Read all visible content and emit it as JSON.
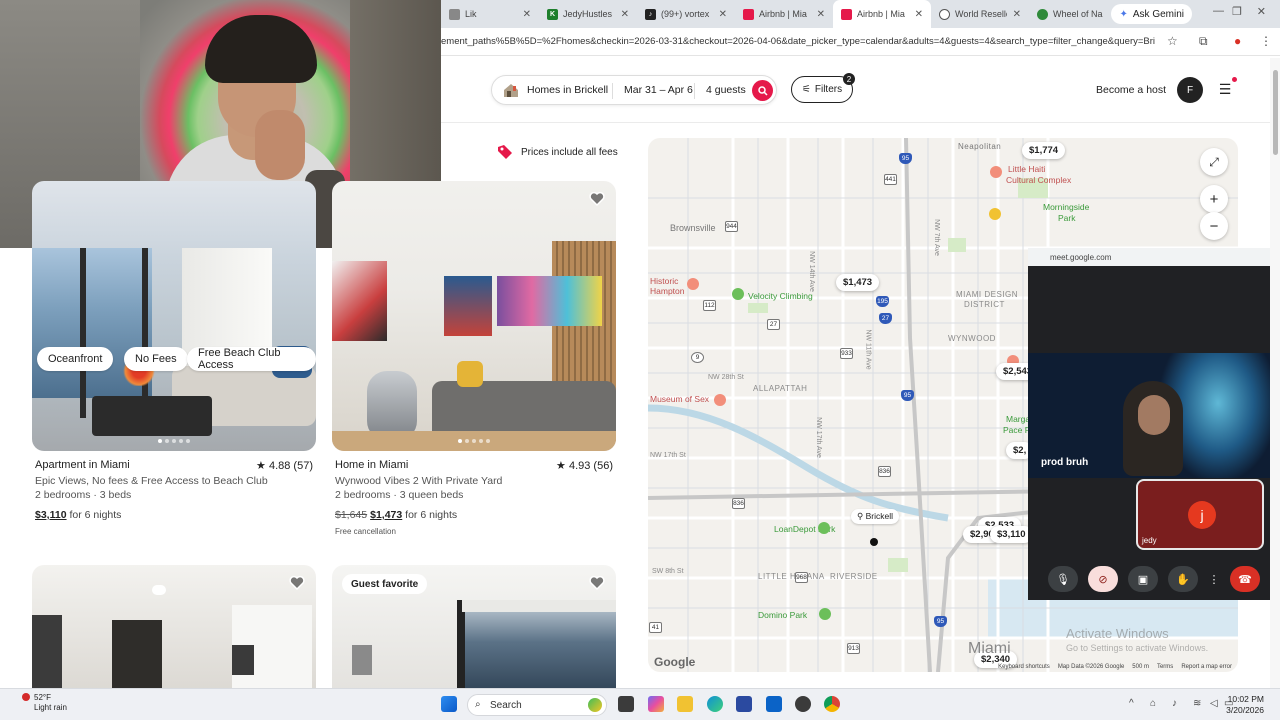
{
  "browser": {
    "tabs": [
      {
        "title": "Lik",
        "color": "#666666",
        "active": false
      },
      {
        "title": "JedyHustles",
        "color": "#1e7f2c",
        "active": false
      },
      {
        "title": "(99+) vortex",
        "color": "#222222",
        "active": false
      },
      {
        "title": "Airbnb | Mia",
        "color": "#e5194a",
        "active": false
      },
      {
        "title": "Airbnb | Mia",
        "color": "#e5194a",
        "active": true
      },
      {
        "title": "World Reselle",
        "color": "#555555",
        "active": false
      },
      {
        "title": "Wheel of Na",
        "color": "#2f8a3a",
        "active": false
      }
    ],
    "ask_gemini": "Ask Gemini",
    "url": "ement_paths%5B%5D=%2Fhomes&checkin=2026-03-31&checkout=2026-04-06&date_picker_type=calendar&adults=4&guests=4&search_type=filter_change&query=Bri..."
  },
  "header": {
    "location": "Homes in Brickell",
    "dates": "Mar 31 – Apr 6",
    "guests": "4 guests",
    "filters_label": "Filters",
    "filters_count": "2",
    "become_host": "Become a host",
    "avatar_initial": "F",
    "prices_note": "Prices include all fees"
  },
  "listings": [
    {
      "type": "Apartment in Miami",
      "rating": "★ 4.88 (57)",
      "desc": "Epic Views, No fees & Free Access to Beach Club",
      "beds": "2 bedrooms · 3 beds",
      "price": "$3,110",
      "price_old": "",
      "per": "for 6 nights",
      "pills": [
        "Oceanfront",
        "No Fees",
        "Free Beach Club Access"
      ]
    },
    {
      "type": "Home in Miami",
      "rating": "★ 4.93 (56)",
      "desc": "Wynwood Vibes 2 With Private Yard",
      "beds": "2 bedrooms · 3 queen beds",
      "price": "$1,473",
      "price_old": "$1,645",
      "per": "for 6 nights",
      "extra": "Free cancellation"
    },
    {
      "badge": ""
    },
    {
      "badge": "Guest favorite"
    }
  ],
  "map": {
    "prices": [
      "$1,774",
      "$1,473",
      "$2,543",
      "$2,",
      "$2,533",
      "$2,90",
      "$3,110",
      "$2,340"
    ],
    "labels": {
      "brownsville": "Brownsville",
      "neapolitan": "Neapolitan",
      "little_haiti": "Little Haiti",
      "cultural": "Cultural Complex",
      "morningside": "Morningside",
      "park": "Park",
      "miami_design": "MIAMI DESIGN",
      "district": "DISTRICT",
      "wynwood": "WYNWOOD",
      "allapattah": "ALLAPATTAH",
      "historic": "Historic",
      "hampton": "Hampton",
      "museum": "Museum of Sex",
      "velocity": "Velocity Climbing",
      "margaret": "Margaret",
      "pace_park": "Pace Park",
      "brickell": "Brickell",
      "loandepot": "LoanDepot Park",
      "little_havana": "LITTLE HAVANA",
      "riverside": "RIVERSIDE",
      "domino": "Domino Park",
      "miami": "Miami",
      "nw28": "NW 28th St",
      "nw17": "NW 17th St",
      "nw14": "NW 14th Ave",
      "nw11": "NW 11th Ave",
      "nw17ave": "NW 17th Ave",
      "nw7": "NW 7th Ave",
      "sw8": "SW 8th St"
    },
    "highways": [
      "95",
      "441",
      "944",
      "112",
      "27",
      "9",
      "933",
      "836",
      "95",
      "195",
      "27",
      "836",
      "968",
      "41",
      "913",
      "95"
    ],
    "google": "Google",
    "attribution": [
      "Keyboard shortcuts",
      "Map Data ©2026 Google",
      "500 m",
      "Terms",
      "Report a map error"
    ],
    "watermark_title": "Activate Windows",
    "watermark_sub": "Go to Settings to activate Windows."
  },
  "meet": {
    "url": "meet.google.com",
    "participant": "prod bruh",
    "self_initial": "j",
    "self_name": "jedy"
  },
  "taskbar": {
    "temp": "52°F",
    "weather": "Light rain",
    "search": "Search",
    "time": "10:02 PM",
    "date": "3/20/2026"
  },
  "colors": {
    "accent": "#e5194a",
    "map_bg": "#f3f1ed"
  }
}
